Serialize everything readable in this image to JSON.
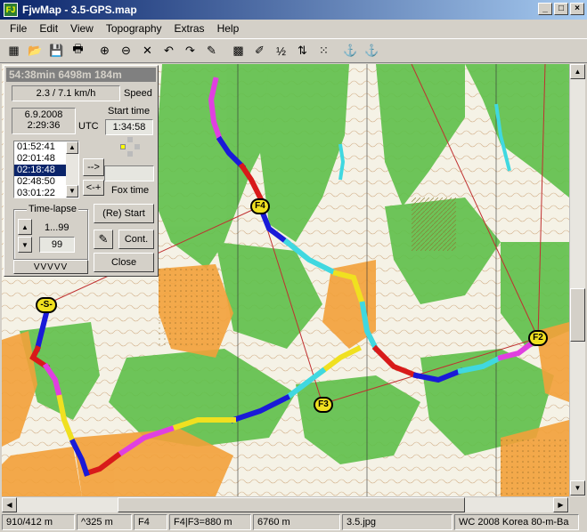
{
  "window": {
    "title": "FjwMap - 3.5-GPS.map",
    "app_icon": "FJ"
  },
  "menu": [
    "File",
    "Edit",
    "View",
    "Topography",
    "Extras",
    "Help"
  ],
  "toolbar": [
    {
      "name": "new-map-icon",
      "glyph": "▦"
    },
    {
      "name": "open-folder-icon",
      "glyph": "📂"
    },
    {
      "name": "save-icon",
      "glyph": "💾"
    },
    {
      "name": "print-icon",
      "glyph": "🖶"
    },
    {
      "name": "zoom-in-icon",
      "glyph": "⊕"
    },
    {
      "name": "zoom-out-icon",
      "glyph": "⊖"
    },
    {
      "name": "delete-icon",
      "glyph": "✕"
    },
    {
      "name": "undo-icon",
      "glyph": "↶"
    },
    {
      "name": "redo-icon",
      "glyph": "↷"
    },
    {
      "name": "pencil-icon",
      "glyph": "✎"
    },
    {
      "name": "grid-icon",
      "glyph": "▩"
    },
    {
      "name": "draw-icon",
      "glyph": "✐"
    },
    {
      "name": "sort-numbers-icon",
      "glyph": "½"
    },
    {
      "name": "sort-order-icon",
      "glyph": "⇅"
    },
    {
      "name": "dots-icon",
      "glyph": "⁙"
    },
    {
      "name": "anchor-icon",
      "glyph": "⚓"
    },
    {
      "name": "anchor-green-icon",
      "glyph": "⚓"
    }
  ],
  "panel": {
    "header": "54:38min  6498m  184m",
    "speed_value": "2.3 / 7.1 km/h",
    "speed_label": "Speed",
    "date": "6.9.2008",
    "time": "2:29:36",
    "utc_label": "UTC",
    "start_time_label": "Start time",
    "start_time_value": "1:34:58",
    "times": [
      "01:52:41",
      "02:01:48",
      "02:18:48",
      "02:48:50",
      "03:01:22"
    ],
    "selected_time_index": 2,
    "arrow_btn": "-->",
    "back_btn": "<-+",
    "fox_time_label": "Fox time",
    "timelapse_label": "Time-lapse",
    "timelapse_range": "1...99",
    "timelapse_value": "99",
    "restart_btn": "(Re) Start",
    "cont_btn": "Cont.",
    "close_btn": "Close",
    "vvv_btn": "VVVVV"
  },
  "map_labels": [
    "F4",
    "-S-",
    "F2",
    "F3"
  ],
  "status": [
    "910/412 m",
    "^325 m",
    "F4",
    "F4|F3=880 m",
    "6760 m",
    "3.5.jpg",
    "WC 2008 Korea 80-m-Ba"
  ],
  "colors": {
    "forest": "#5fc04a",
    "open": "#f3a13a",
    "track_blue": "#1a1ad8",
    "track_red": "#d81a1a",
    "track_yellow": "#f0e020",
    "track_cyan": "#40d8e0",
    "track_magenta": "#e040e0"
  }
}
